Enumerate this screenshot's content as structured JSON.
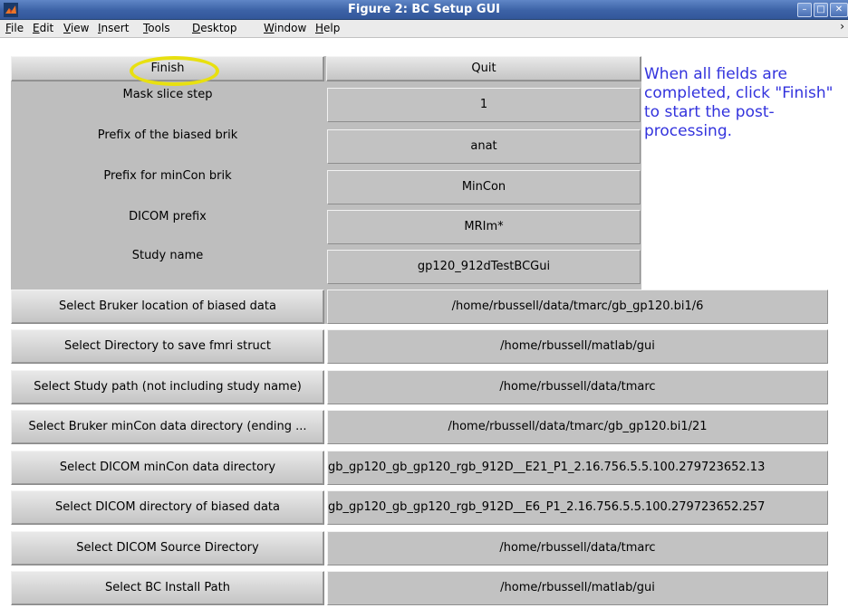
{
  "window": {
    "title": "Figure 2: BC Setup GUI"
  },
  "menu": {
    "items": [
      {
        "mnemonic": "F",
        "rest": "ile"
      },
      {
        "mnemonic": "E",
        "rest": "dit"
      },
      {
        "mnemonic": "V",
        "rest": "iew"
      },
      {
        "mnemonic": "I",
        "rest": "nsert"
      },
      {
        "mnemonic": "T",
        "rest": "ools"
      },
      {
        "mnemonic": "D",
        "rest": "esktop"
      },
      {
        "mnemonic": "W",
        "rest": "indow"
      },
      {
        "mnemonic": "H",
        "rest": "elp"
      }
    ]
  },
  "top_buttons": {
    "finish": "Finish",
    "quit": "Quit"
  },
  "note": "When all fields are completed, click \"Finish\" to start the post-processing.",
  "fields": [
    {
      "label": "Mask slice step",
      "value": "1"
    },
    {
      "label": "Prefix of the biased brik",
      "value": "anat"
    },
    {
      "label": "Prefix for minCon brik",
      "value": "MinCon"
    },
    {
      "label": "DICOM prefix",
      "value": "MRIm*"
    },
    {
      "label": "Study name",
      "value": "gp120_912dTestBCGui"
    }
  ],
  "selectors": [
    {
      "button": "Select Bruker location of biased data",
      "value": "/home/rbussell/data/tmarc/gb_gp120.bi1/6"
    },
    {
      "button": "Select Directory to save fmri struct",
      "value": "/home/rbussell/matlab/gui"
    },
    {
      "button": "Select Study path (not including study name)",
      "value": "/home/rbussell/data/tmarc"
    },
    {
      "button": "Select Bruker minCon data directory (ending ...",
      "value": "/home/rbussell/data/tmarc/gb_gp120.bi1/21"
    },
    {
      "button": "Select DICOM minCon data directory",
      "value": "gb_gp120_gb_gp120_rgb_912D__E21_P1_2.16.756.5.5.100.279723652.13"
    },
    {
      "button": "Select DICOM directory of biased data",
      "value": "gb_gp120_gb_gp120_rgb_912D__E6_P1_2.16.756.5.5.100.279723652.257"
    },
    {
      "button": "Select DICOM Source Directory",
      "value": "/home/rbussell/data/tmarc"
    },
    {
      "button": "Select BC Install Path",
      "value": "/home/rbussell/matlab/gui"
    }
  ]
}
